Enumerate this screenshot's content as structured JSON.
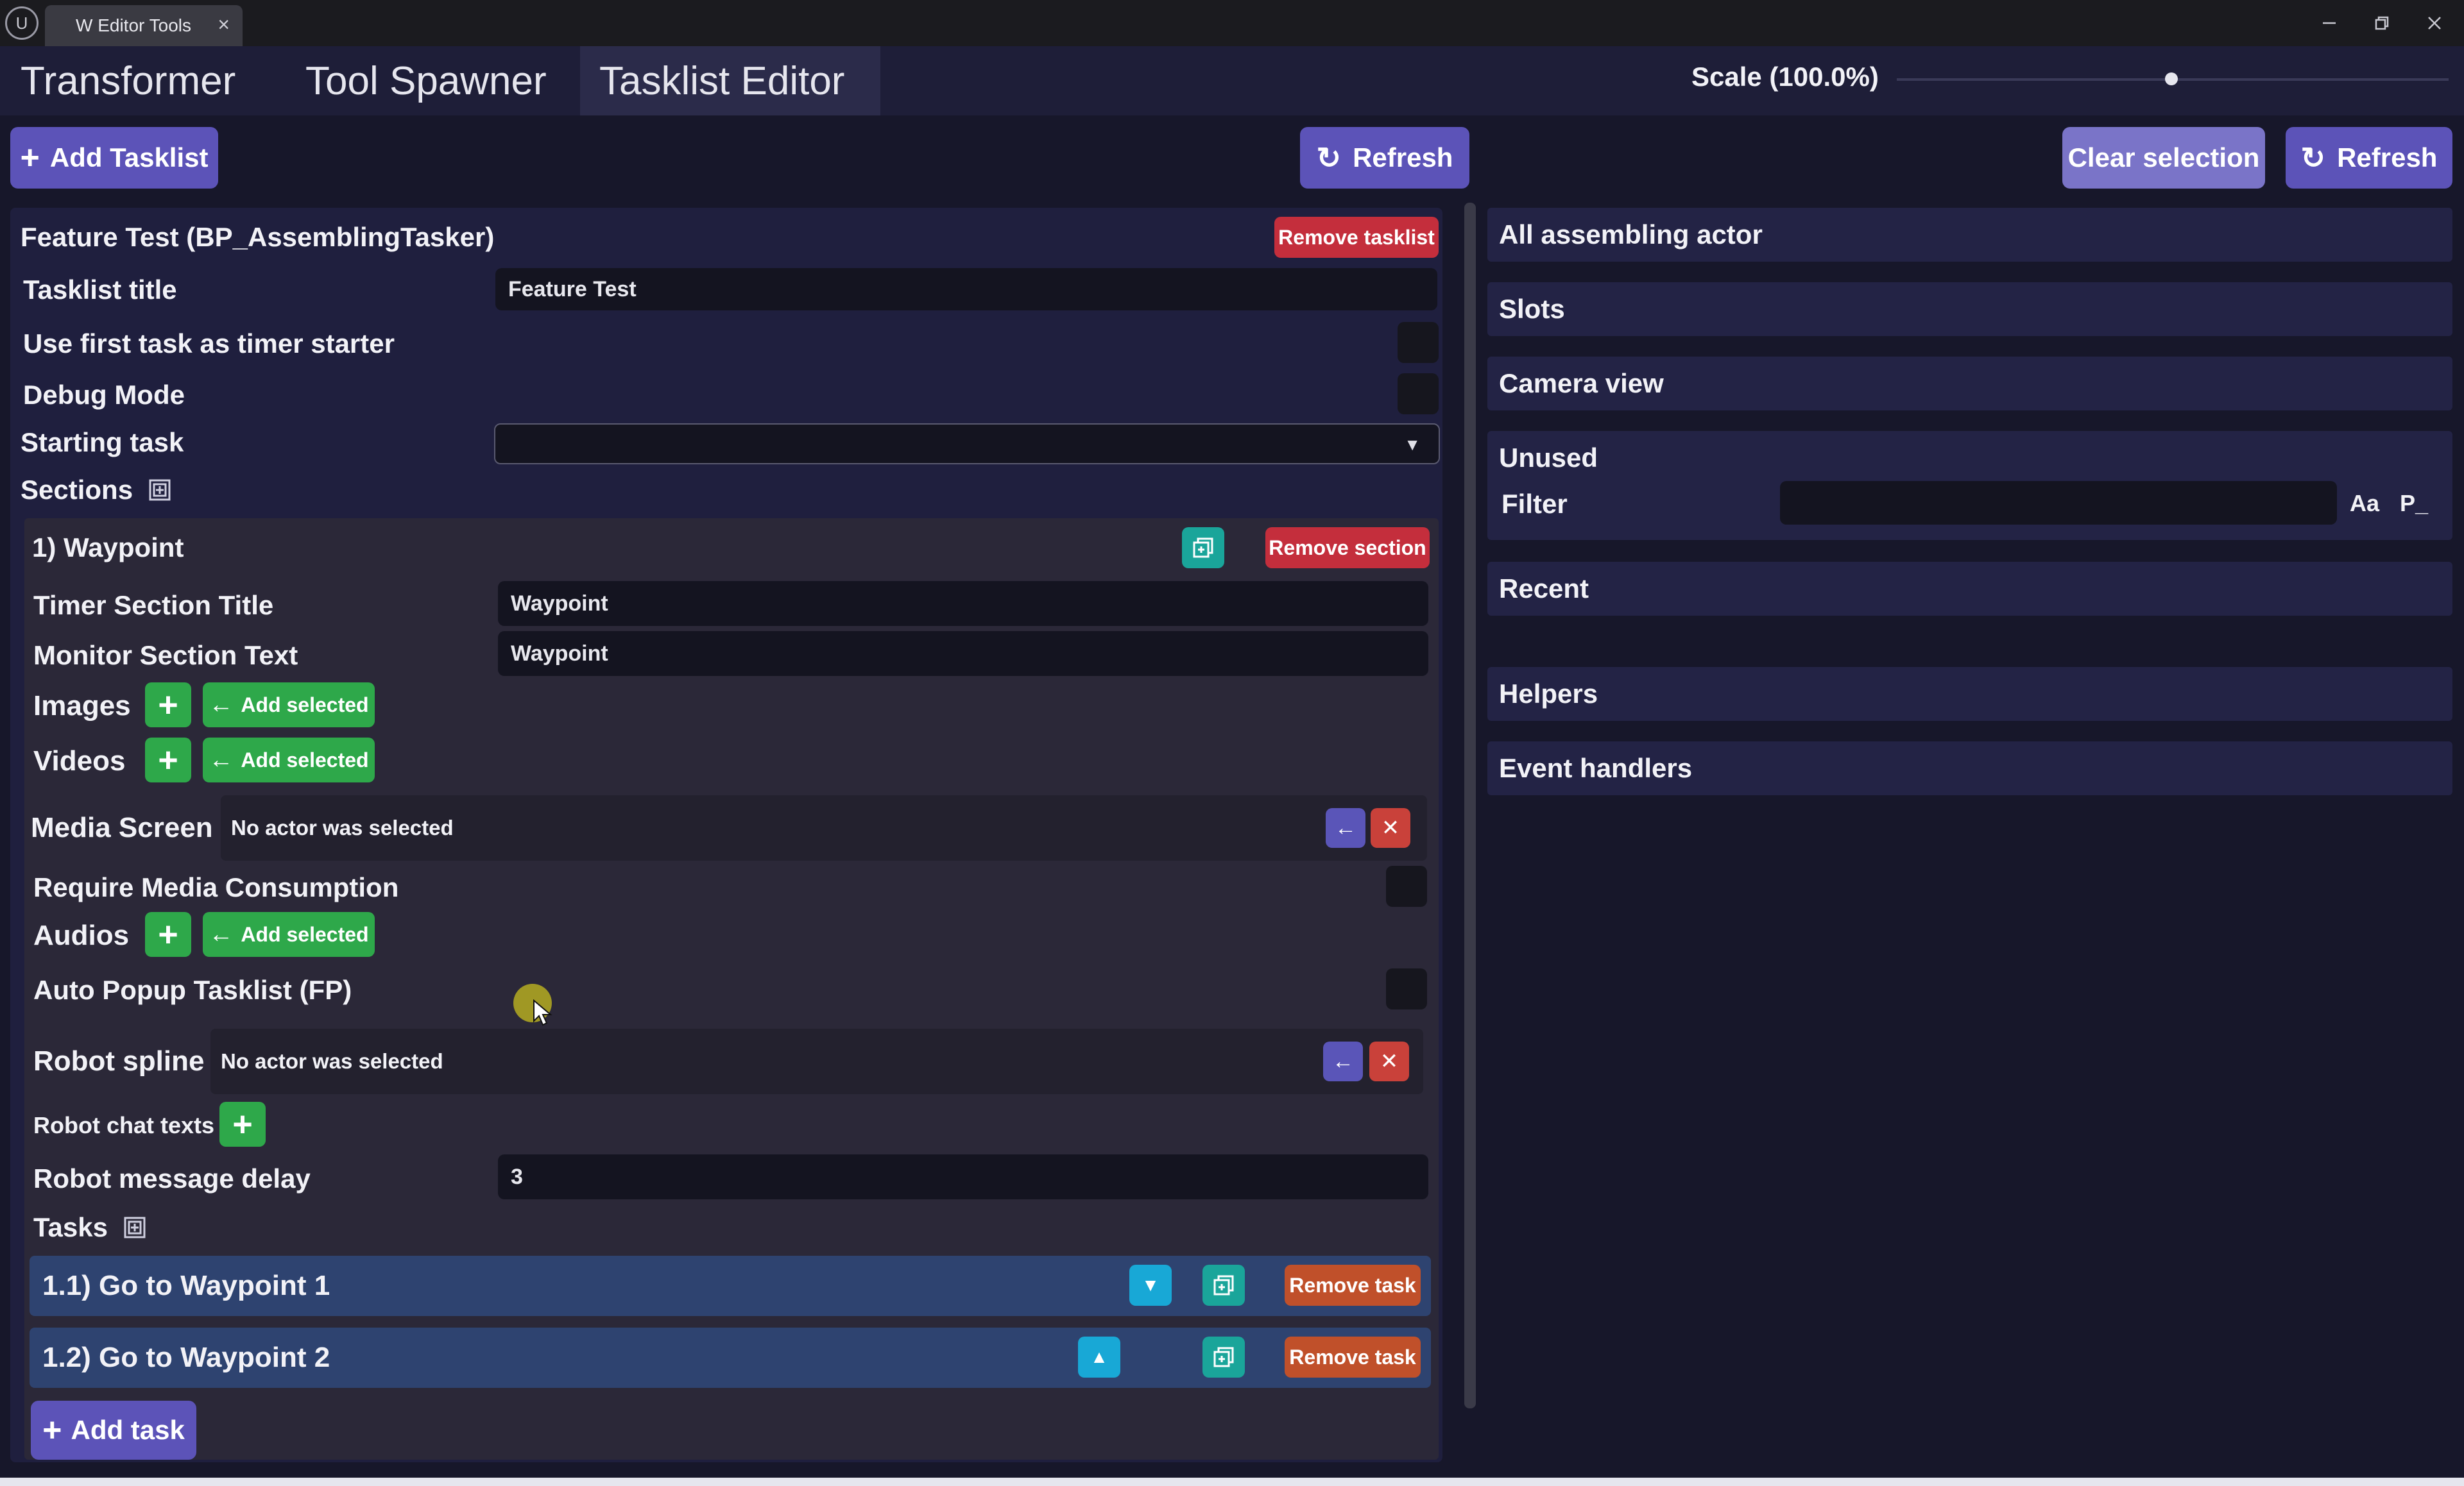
{
  "window": {
    "tab_title": "W Editor Tools",
    "tab_close": "×",
    "logo": "U",
    "icons": [
      "ue-logo-icon",
      "minimize-icon",
      "restore-icon",
      "close-icon"
    ]
  },
  "main_tabs": [
    {
      "label": "Transformer",
      "active": false
    },
    {
      "label": "Tool Spawner",
      "active": false
    },
    {
      "label": "Tasklist Editor",
      "active": true
    }
  ],
  "scale": {
    "label": "Scale (100.0%)",
    "value_percent": 100.0
  },
  "toolbar": {
    "add_tasklist": "Add Tasklist",
    "refresh_left": "Refresh",
    "clear_selection": "Clear selection",
    "refresh_right": "Refresh"
  },
  "tasklist": {
    "header": "Feature Test (BP_AssemblingTasker)",
    "remove_tasklist": "Remove tasklist",
    "fields": {
      "title_label": "Tasklist title",
      "title_value": "Feature Test",
      "timer_starter_label": "Use first task as timer starter",
      "debug_label": "Debug Mode",
      "starting_task_label": "Starting task",
      "starting_task_value": "",
      "sections_label": "Sections"
    }
  },
  "section": {
    "header": "1) Waypoint",
    "remove_section": "Remove section",
    "timer_title_label": "Timer Section Title",
    "timer_title_value": "Waypoint",
    "monitor_text_label": "Monitor Section Text",
    "monitor_text_value": "Waypoint",
    "images_label": "Images",
    "videos_label": "Videos",
    "audios_label": "Audios",
    "add_selected": "Add selected",
    "media_screen_label": "Media Screen",
    "media_screen_value": "No actor was selected",
    "require_media_label": "Require Media Consumption",
    "auto_popup_label": "Auto Popup Tasklist (FP)",
    "robot_spline_label": "Robot spline",
    "robot_spline_value": "No actor was selected",
    "robot_chat_label": "Robot chat texts",
    "robot_delay_label": "Robot message delay",
    "robot_delay_value": "3",
    "tasks_label": "Tasks",
    "tasks": [
      {
        "label": "1.1) Go to Waypoint 1",
        "remove": "Remove task"
      },
      {
        "label": "1.2) Go to Waypoint 2",
        "remove": "Remove task"
      }
    ],
    "add_task": "Add task"
  },
  "right_panel": {
    "items": [
      "All assembling actor",
      "Slots",
      "Camera view"
    ],
    "unused_label": "Unused",
    "filter_label": "Filter",
    "filter_value": "",
    "match_case": "Aa",
    "path_toggle": "P_",
    "items2": [
      "Recent",
      "Helpers",
      "Event handlers"
    ]
  }
}
